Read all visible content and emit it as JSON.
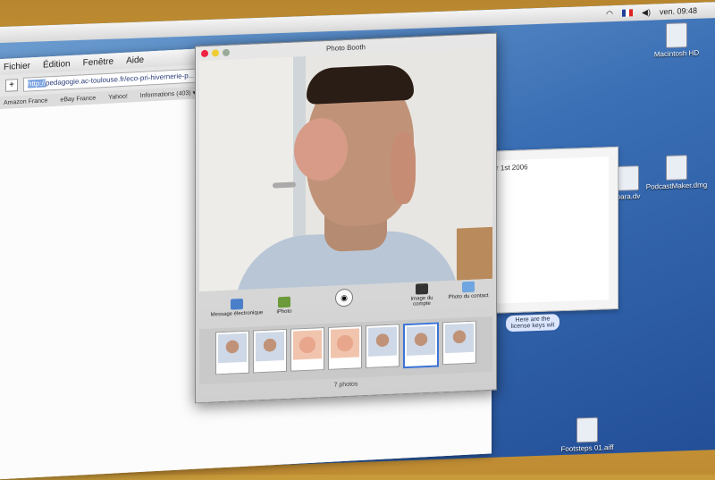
{
  "system": {
    "time": "ven. 09:48"
  },
  "browser": {
    "menu": [
      "Fichier",
      "Édition",
      "Fenêtre",
      "Aide"
    ],
    "add_tab": "+",
    "url_prefix": "http://",
    "url_rest": "pedagogie.ac-toulouse.fr/eco-pri-hivernerie-p...",
    "bookmarks": [
      "Amazon France",
      "eBay France",
      "Yahoo!",
      "Informations (403) ▾"
    ]
  },
  "desktop": {
    "icons": [
      {
        "label": "Macintosh HD"
      },
      {
        "label": "bara.dv"
      },
      {
        "label": "PodcastMaker.dmg"
      },
      {
        "label": "Footsteps 01.aiff"
      }
    ],
    "textwin_text": "r 1st 2006",
    "note": "Here are the license keys wit"
  },
  "photobooth": {
    "title": "Photo Booth",
    "buttons": {
      "email": "Message électronique",
      "iphoto": "iPhoto",
      "account": "Image du compte",
      "contact": "Photo du contact"
    },
    "count": "7 photos"
  }
}
